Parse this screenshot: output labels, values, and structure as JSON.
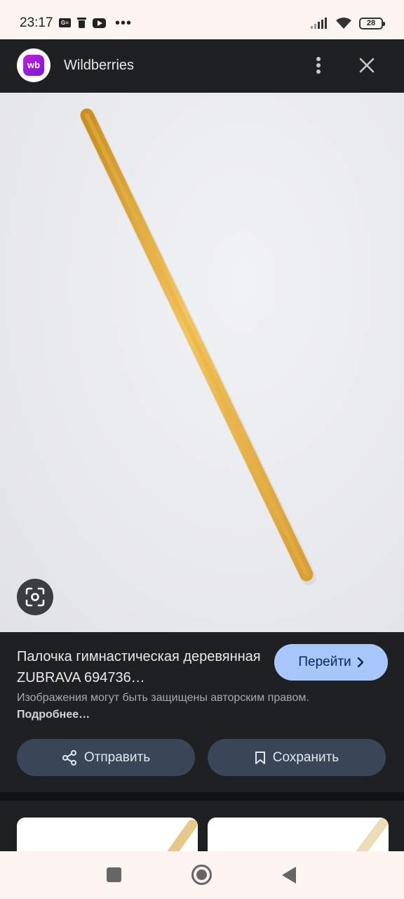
{
  "status_bar": {
    "time": "23:17",
    "notification_icons": [
      "ge-badge-icon",
      "trash-icon",
      "youtube-icon"
    ],
    "overflow": "•••",
    "battery": "28"
  },
  "app_bar": {
    "logo_text": "wb",
    "site_name": "Wildberries"
  },
  "result": {
    "title": "Палочка гимнастическая деревянная ZUBRAVA 694736…",
    "goto_label": "Перейти",
    "copyright_text": "Изображения могут быть защищены авторским правом.",
    "more_link": "Подробнее…",
    "share_label": "Отправить",
    "save_label": "Сохранить"
  },
  "colors": {
    "accent_button": "#a8c7fa",
    "action_button": "#3a4658",
    "panel_background": "#1f2022",
    "brand_gradient": [
      "#c41ce0",
      "#7b18d9"
    ]
  }
}
